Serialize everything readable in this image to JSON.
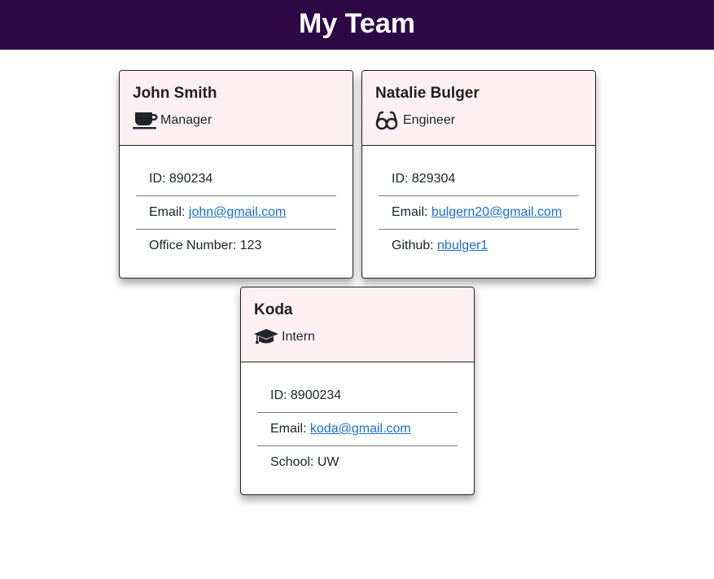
{
  "header": {
    "title": "My Team"
  },
  "colors": {
    "header_bg": "#2d0845",
    "card_head_bg": "#fff0f4",
    "link": "#1a6fd6"
  },
  "cards": [
    {
      "name": "John Smith",
      "role": "Manager",
      "icon": "coffee-mug-icon",
      "id_label": "ID: 890234",
      "email_prefix": "Email: ",
      "email": "john@gmail.com",
      "extra_prefix": "Office Number: 123",
      "extra_link": ""
    },
    {
      "name": "Natalie Bulger",
      "role": "Engineer",
      "icon": "glasses-icon",
      "id_label": "ID: 829304",
      "email_prefix": "Email: ",
      "email": "bulgern20@gmail.com",
      "extra_prefix": "Github: ",
      "extra_link": "nbulger1"
    },
    {
      "name": "Koda",
      "role": "Intern",
      "icon": "graduation-cap-icon",
      "id_label": "ID: 8900234",
      "email_prefix": "Email: ",
      "email": "koda@gmail.com",
      "extra_prefix": "School: UW",
      "extra_link": ""
    }
  ]
}
